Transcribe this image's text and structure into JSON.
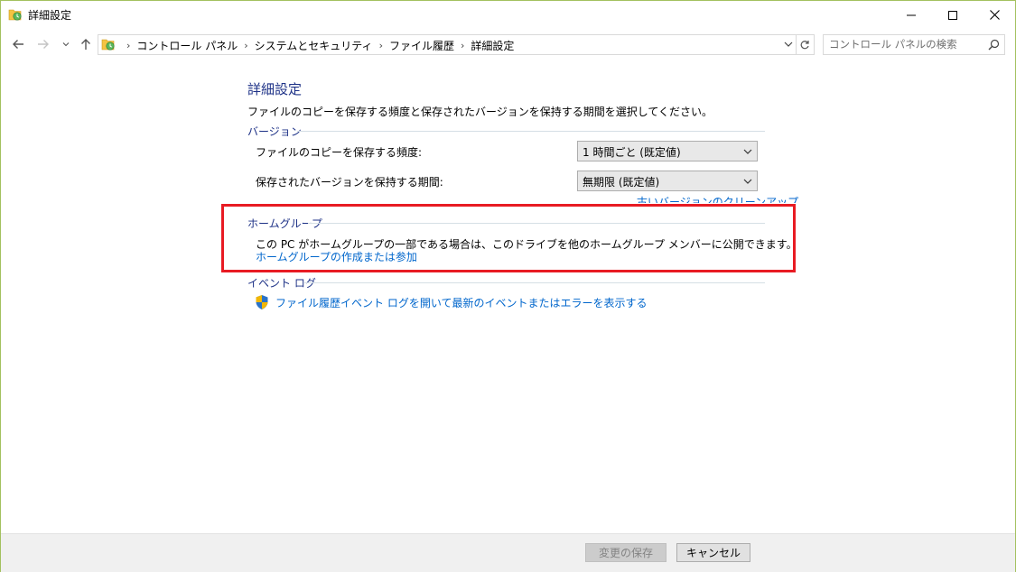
{
  "window": {
    "title": "詳細設定",
    "controls": {
      "minimize_icon": "minimize-icon",
      "maximize_icon": "maximize-icon",
      "close_icon": "close-icon"
    }
  },
  "nav": {
    "breadcrumb": [
      "コントロール パネル",
      "システムとセキュリティ",
      "ファイル履歴",
      "詳細設定"
    ],
    "search_placeholder": "コントロール パネルの検索"
  },
  "main": {
    "title": "詳細設定",
    "description": "ファイルのコピーを保存する頻度と保存されたバージョンを保持する期間を選択してください。",
    "versions": {
      "heading": "バージョン",
      "frequency_label": "ファイルのコピーを保存する頻度:",
      "frequency_value": "1 時間ごと (既定値)",
      "retention_label": "保存されたバージョンを保持する期間:",
      "retention_value": "無期限 (既定値)",
      "cleanup_link": "古いバージョンのクリーンアップ"
    },
    "homegroup": {
      "heading": "ホームグループ",
      "text": "この PC がホームグループの一部である場合は、このドライブを他のホームグループ メンバーに公開できます。",
      "link": "ホームグループの作成または参加"
    },
    "eventlog": {
      "heading": "イベント ログ",
      "link": "ファイル履歴イベント ログを開いて最新のイベントまたはエラーを表示する"
    }
  },
  "footer": {
    "save_label": "変更の保存",
    "cancel_label": "キャンセル"
  },
  "colors": {
    "heading": "#1e3287",
    "link": "#0066cc",
    "highlight_border": "#e81b23",
    "window_border": "#a3c15f"
  }
}
